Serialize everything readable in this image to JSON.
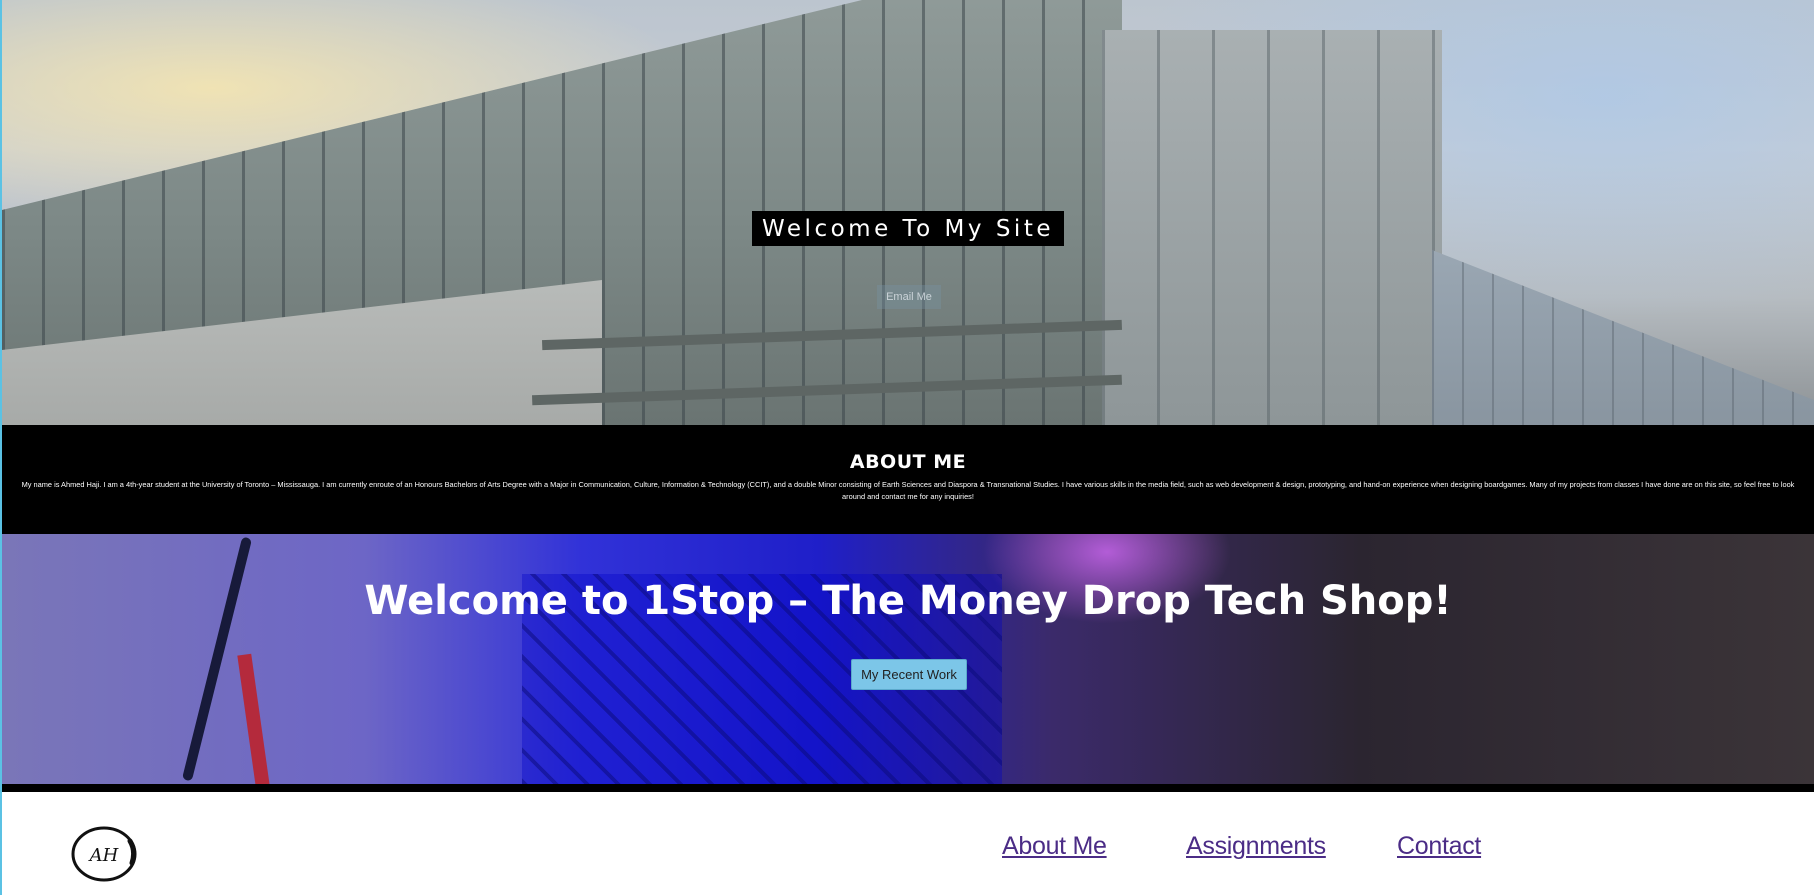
{
  "hero": {
    "title": "Welcome To My Site",
    "email_button": "Email Me"
  },
  "about": {
    "heading": "ABOUT ME",
    "text": "My name is Ahmed Haji. I am a 4th-year student at the University of Toronto – Mississauga. I am currently enroute of an Honours Bachelors of Arts Degree with a Major in Communication, Culture, Information & Technology (CCIT), and a double Minor consisting of Earth Sciences and Diaspora & Transnational Studies. I have various skills in the media field, such as web development & design, prototyping, and hand-on experience when designing boardgames. Many of my projects from classes I have done are on this site, so feel free to look around and contact me for any inquiries!"
  },
  "shop": {
    "title": "Welcome to 1Stop – The Money Drop Tech Shop!",
    "button": "My Recent Work"
  },
  "footer": {
    "logo_text": "AH",
    "nav": [
      {
        "label": "About Me"
      },
      {
        "label": "Assignments"
      },
      {
        "label": "Contact"
      }
    ]
  },
  "colors": {
    "accent_button": "#7cc6e8",
    "nav_link": "#4b2c86",
    "about_bg": "#000000"
  }
}
